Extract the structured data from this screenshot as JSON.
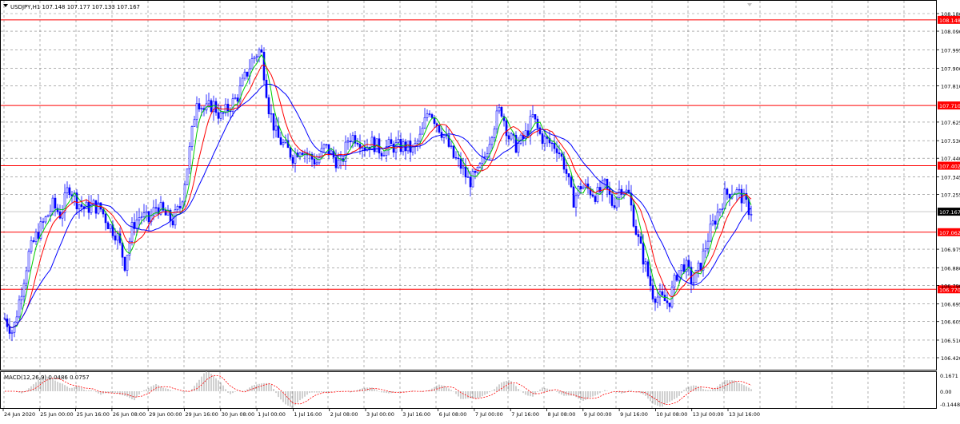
{
  "main_header": {
    "caret_icon": "triangle-down-icon",
    "text": "USDJPY,H1  107.148 107.177 107.133 107.167"
  },
  "macd_header": {
    "text": "MACD(12,26,9) 0.0486 0.0757"
  },
  "price_axis": {
    "ticks": [
      "108.180",
      "108.090",
      "107.995",
      "107.900",
      "107.810",
      "107.625",
      "107.530",
      "107.440",
      "107.345",
      "107.255",
      "106.975",
      "106.880",
      "106.790",
      "106.695",
      "106.605",
      "106.510",
      "106.420"
    ]
  },
  "levels": [
    {
      "label": "108.148",
      "price": 108.148
    },
    {
      "label": "107.710",
      "price": 107.71
    },
    {
      "label": "107.402",
      "price": 107.402
    },
    {
      "label": "107.062",
      "price": 107.062
    },
    {
      "label": "106.770",
      "price": 106.77
    }
  ],
  "current_price": {
    "label": "107.167",
    "price": 107.167
  },
  "macd_axis": {
    "ticks": [
      "0.1671",
      "0.00",
      "-0.1448"
    ]
  },
  "time_axis": {
    "labels": [
      "24 Jun 2020",
      "25 Jun 00:00",
      "25 Jun 16:00",
      "26 Jun 08:00",
      "29 Jun 00:00",
      "29 Jun 16:00",
      "30 Jun 08:00",
      "1 Jul 00:00",
      "1 Jul 16:00",
      "2 Jul 08:00",
      "3 Jul 00:00",
      "3 Jul 16:00",
      "6 Jul 08:00",
      "7 Jul 00:00",
      "7 Jul 16:00",
      "8 Jul 08:00",
      "9 Jul 00:00",
      "9 Jul 16:00",
      "10 Jul 08:00",
      "13 Jul 00:00",
      "13 Jul 16:00"
    ]
  },
  "colors": {
    "candles": "#0000ff",
    "ma_fast": "#00cc00",
    "ma_mid": "#ff0000",
    "ma_slow": "#0000ff",
    "level_line": "#ff0000",
    "level_label_bg": "#ff0000",
    "current_label_bg": "#000000",
    "grid": "#808080",
    "macd_hist": "#a0a0a0",
    "macd_signal": "#ff0000"
  },
  "chart_data": {
    "type": "line",
    "symbol": "USDJPY",
    "timeframe": "H1",
    "approx_close": [
      [
        0,
        106.62
      ],
      [
        10,
        106.55
      ],
      [
        20,
        106.75
      ],
      [
        30,
        106.95
      ],
      [
        40,
        107.05
      ],
      [
        50,
        107.12
      ],
      [
        60,
        107.2
      ],
      [
        70,
        107.15
      ],
      [
        80,
        107.3
      ],
      [
        90,
        107.22
      ],
      [
        100,
        107.18
      ],
      [
        110,
        107.2
      ],
      [
        120,
        107.18
      ],
      [
        130,
        107.1
      ],
      [
        140,
        107.05
      ],
      [
        150,
        106.9
      ],
      [
        160,
        107.1
      ],
      [
        170,
        107.15
      ],
      [
        180,
        107.12
      ],
      [
        190,
        107.2
      ],
      [
        200,
        107.15
      ],
      [
        210,
        107.12
      ],
      [
        220,
        107.2
      ],
      [
        230,
        107.45
      ],
      [
        240,
        107.75
      ],
      [
        250,
        107.68
      ],
      [
        260,
        107.72
      ],
      [
        270,
        107.65
      ],
      [
        280,
        107.7
      ],
      [
        290,
        107.75
      ],
      [
        300,
        107.85
      ],
      [
        310,
        107.95
      ],
      [
        320,
        108.0
      ],
      [
        325,
        107.85
      ],
      [
        330,
        107.7
      ],
      [
        340,
        107.55
      ],
      [
        350,
        107.5
      ],
      [
        360,
        107.45
      ],
      [
        370,
        107.5
      ],
      [
        380,
        107.45
      ],
      [
        390,
        107.42
      ],
      [
        400,
        107.5
      ],
      [
        410,
        107.45
      ],
      [
        420,
        107.4
      ],
      [
        430,
        107.55
      ],
      [
        440,
        107.55
      ],
      [
        450,
        107.5
      ],
      [
        460,
        107.52
      ],
      [
        470,
        107.48
      ],
      [
        480,
        107.5
      ],
      [
        490,
        107.5
      ],
      [
        500,
        107.5
      ],
      [
        510,
        107.48
      ],
      [
        520,
        107.55
      ],
      [
        530,
        107.7
      ],
      [
        540,
        107.62
      ],
      [
        550,
        107.55
      ],
      [
        560,
        107.45
      ],
      [
        570,
        107.4
      ],
      [
        580,
        107.32
      ],
      [
        590,
        107.35
      ],
      [
        600,
        107.45
      ],
      [
        610,
        107.6
      ],
      [
        620,
        107.7
      ],
      [
        630,
        107.55
      ],
      [
        640,
        107.5
      ],
      [
        650,
        107.55
      ],
      [
        660,
        107.65
      ],
      [
        670,
        107.55
      ],
      [
        680,
        107.52
      ],
      [
        690,
        107.5
      ],
      [
        700,
        107.4
      ],
      [
        710,
        107.22
      ],
      [
        720,
        107.3
      ],
      [
        730,
        107.28
      ],
      [
        740,
        107.25
      ],
      [
        750,
        107.3
      ],
      [
        760,
        107.2
      ],
      [
        770,
        107.3
      ],
      [
        780,
        107.25
      ],
      [
        790,
        107.05
      ],
      [
        800,
        106.9
      ],
      [
        810,
        106.75
      ],
      [
        820,
        106.72
      ],
      [
        830,
        106.7
      ],
      [
        840,
        106.85
      ],
      [
        850,
        106.9
      ],
      [
        860,
        106.8
      ],
      [
        870,
        106.9
      ],
      [
        880,
        107.05
      ],
      [
        890,
        107.15
      ],
      [
        900,
        107.25
      ],
      [
        910,
        107.28
      ],
      [
        920,
        107.25
      ],
      [
        930,
        107.18
      ],
      [
        935,
        107.167
      ]
    ],
    "ylim": [
      106.42,
      108.18
    ]
  }
}
